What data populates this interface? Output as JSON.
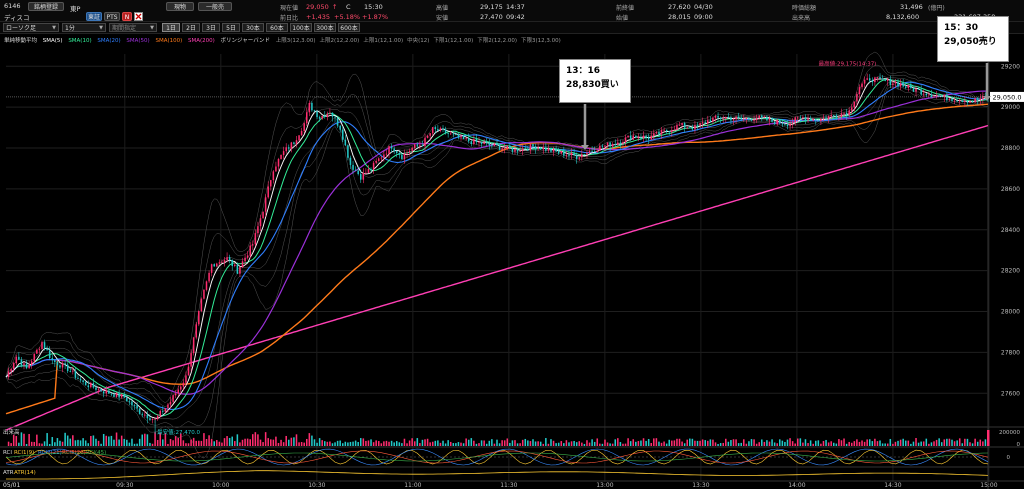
{
  "header": {
    "code": "6146",
    "name": "ディスコ",
    "btn_brand": "銘柄登録",
    "market": "東P",
    "btn_tosho": "東証",
    "btn_pts": "PTS",
    "btn_n": "N",
    "btn_genbutsu": "現物",
    "btn_ippan": "一般売",
    "price_label": "現在値",
    "price_value": "29,050",
    "price_mark": "↑",
    "price_flag": "C",
    "price_time": "15:30",
    "prev_label": "前日比",
    "prev_value": "+1,435",
    "prev_pct": "+5.18%",
    "prev_pct2": "+1.87%",
    "high_label": "高値",
    "high_value": "29,175",
    "high_time": "14:37",
    "low_label": "安値",
    "low_value": "27,470",
    "low_time": "09:42",
    "close_label": "前終値",
    "close_value": "27,620",
    "close_date": "04/30",
    "open_label": "始値",
    "open_value": "28,015",
    "open_time": "09:00",
    "mcap_label": "時価総額",
    "mcap_value": "31,496",
    "mcap_unit": "(億円)",
    "vol_label": "出来高",
    "vol_value": "8,132,600",
    "turnover_value": "231,607,358"
  },
  "toolbar": {
    "chart_type": "ローソク足",
    "interval": "1分",
    "period": "期間指定",
    "timeframes": [
      "1日",
      "2日",
      "3日",
      "5日",
      "30本",
      "60本",
      "100本",
      "300本",
      "600本"
    ],
    "active_timeframe": 0
  },
  "indicators": {
    "label": "単純移動平均",
    "sma5": "SMA(5)",
    "sma10": "SMA(10)",
    "sma20": "SMA(20)",
    "sma50": "SMA(50)",
    "sma100": "SMA(100)",
    "sma200": "SMA(200)",
    "bb": "ボリンジャーバンド",
    "bb_items": [
      "上限3(12,3.00)",
      "上限2(12,2.00)",
      "上限1(12,1.00)",
      "中央(12)",
      "下限1(12,1.00)",
      "下限2(12,2.00)",
      "下限3(12,3.00)"
    ]
  },
  "annotations": {
    "buy_time": "13：16",
    "buy_text": "28,830買い",
    "sell_time": "15：30",
    "sell_text": "29,050売り"
  },
  "chart_labels": {
    "high_label": "最高値:29,175(14:37)",
    "low_label": "最安値:27,470.0",
    "current_price": "29,050.0",
    "volume_label": "出来高",
    "rci_label": "RCI",
    "rci_items": [
      "RCI1(9)",
      "RCI2(21)",
      "RCI3(26)",
      "RCI(45)"
    ],
    "atr_label": "ATR",
    "atr_item": "ATR(14)",
    "date_label": "05/01"
  },
  "colors": {
    "sma5": "#ffffff",
    "sma10": "#33ee99",
    "sma20": "#2f7fff",
    "sma50": "#9b30d9",
    "sma100": "#ff7a1a",
    "sma200": "#ff3fb4",
    "up": "#ff2d6f",
    "down": "#22c9c9",
    "highlabel": "#ff3f7f"
  },
  "chart_data": {
    "type": "candlestick",
    "x_ticks": [
      "09:30",
      "10:00",
      "10:30",
      "11:00",
      "11:30",
      "13:00",
      "13:30",
      "14:00",
      "14:30",
      "15:00"
    ],
    "y_ticks": [
      27600,
      27800,
      28000,
      28200,
      28400,
      28600,
      28800,
      29000,
      29200
    ],
    "ylim": [
      27440,
      29260
    ],
    "volume_ticks": [
      200000,
      0
    ],
    "rci_ticks": [
      0
    ],
    "price_path": [
      [
        0,
        27680
      ],
      [
        4,
        27780
      ],
      [
        8,
        27720
      ],
      [
        14,
        27850
      ],
      [
        18,
        27760
      ],
      [
        24,
        27720
      ],
      [
        30,
        27650
      ],
      [
        38,
        27610
      ],
      [
        46,
        27580
      ],
      [
        52,
        27510
      ],
      [
        58,
        27470
      ],
      [
        64,
        27560
      ],
      [
        70,
        27680
      ],
      [
        76,
        28050
      ],
      [
        80,
        28230
      ],
      [
        86,
        28260
      ],
      [
        90,
        28200
      ],
      [
        96,
        28330
      ],
      [
        100,
        28500
      ],
      [
        104,
        28700
      ],
      [
        108,
        28780
      ],
      [
        112,
        28830
      ],
      [
        116,
        28920
      ],
      [
        118,
        29010
      ],
      [
        122,
        28950
      ],
      [
        126,
        28980
      ],
      [
        130,
        28900
      ],
      [
        134,
        28720
      ],
      [
        138,
        28660
      ],
      [
        142,
        28700
      ],
      [
        146,
        28760
      ],
      [
        150,
        28810
      ],
      [
        154,
        28760
      ],
      [
        158,
        28800
      ],
      [
        162,
        28820
      ],
      [
        166,
        28890
      ],
      [
        170,
        28880
      ],
      [
        174,
        28860
      ],
      [
        178,
        28840
      ],
      [
        182,
        28830
      ],
      [
        190,
        28810
      ],
      [
        198,
        28790
      ],
      [
        206,
        28810
      ],
      [
        214,
        28780
      ],
      [
        222,
        28760
      ],
      [
        230,
        28800
      ],
      [
        238,
        28830
      ],
      [
        244,
        28860
      ],
      [
        250,
        28850
      ],
      [
        256,
        28880
      ],
      [
        262,
        28910
      ],
      [
        268,
        28900
      ],
      [
        274,
        28940
      ],
      [
        280,
        28950
      ],
      [
        286,
        28940
      ],
      [
        292,
        28950
      ],
      [
        298,
        28930
      ],
      [
        304,
        28920
      ],
      [
        310,
        28950
      ],
      [
        316,
        28940
      ],
      [
        322,
        28960
      ],
      [
        328,
        28980
      ],
      [
        332,
        29100
      ],
      [
        336,
        29140
      ],
      [
        340,
        29130
      ],
      [
        346,
        29120
      ],
      [
        352,
        29090
      ],
      [
        358,
        29070
      ],
      [
        364,
        29050
      ],
      [
        370,
        29040
      ],
      [
        376,
        29030
      ],
      [
        382,
        29050
      ]
    ]
  }
}
